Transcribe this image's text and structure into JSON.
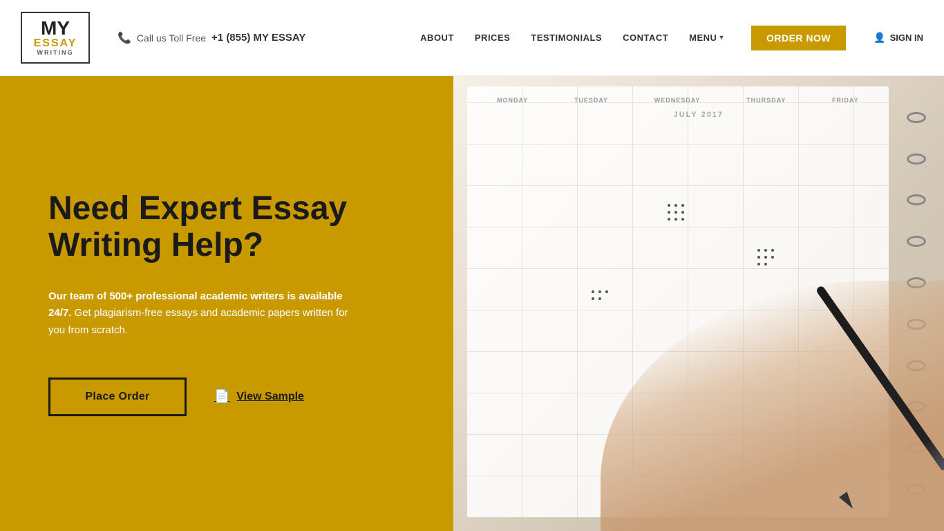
{
  "header": {
    "logo": {
      "my": "MY",
      "essay": "ESSAY",
      "writing": "WRITING"
    },
    "phone": {
      "label": "Call us Toll Free",
      "number": "+1 (855) MY ESSAY"
    },
    "nav": {
      "about": "ABOUT",
      "prices": "PRICES",
      "testimonials": "TESTIMONIALS",
      "contact": "CONTACT",
      "menu": "MENU",
      "order_now": "ORDER NOW",
      "sign_in": "SIGN IN"
    }
  },
  "hero": {
    "title": "Need Expert Essay Writing Help?",
    "description_bold": "Our team of 500+ professional academic writers is available 24/7.",
    "description_regular": " Get plagiarism-free essays and academic papers written for you from scratch.",
    "place_order": "Place Order",
    "view_sample": "View Sample"
  },
  "colors": {
    "gold": "#c89a00",
    "dark": "#1a1a1a",
    "white": "#ffffff"
  }
}
